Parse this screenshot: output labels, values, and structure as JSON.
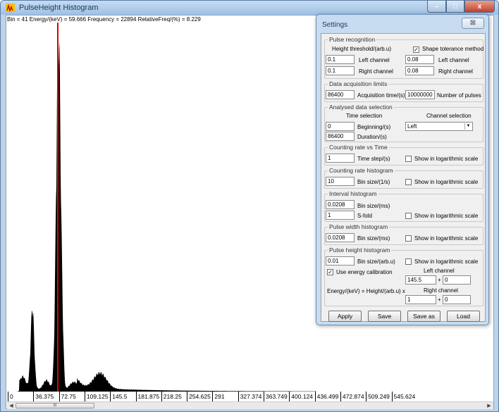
{
  "window": {
    "title": "PulseHeight Histogram",
    "info_line": "Bin = 41  Energy/(keV) = 59.666  Frequency = 22894  RelativeFreq/(%) = 8.229",
    "buttons": {
      "minimize": "–",
      "maximize": "□",
      "close": "x"
    }
  },
  "histogram": {
    "bar_color": "#000000",
    "marker_color": "#e00000",
    "marker_bin": 41,
    "axis_labels": [
      "0",
      "36.375",
      "72.75",
      "109.125",
      "145.5",
      "181.875",
      "218.25",
      "254.625",
      "291",
      "327.374",
      "363.749",
      "400.124",
      "436.499",
      "472.874",
      "509.249",
      "545.624"
    ],
    "scroll_thumb": "III"
  },
  "settings": {
    "title": "Settings",
    "close_glyph": "⊠",
    "pulse_recognition": {
      "title": "Pulse recognition",
      "height_threshold_label": "Height threshold/(arb.u)",
      "shape_tolerance_checked": true,
      "shape_tolerance_label": "Shape tolerance method",
      "left_value": "0.1",
      "left_label": "Left channel",
      "left_tol_value": "0.08",
      "left_tol_label": "Left channel",
      "right_value": "0.1",
      "right_label": "Right channel",
      "right_tol_value": "0.08",
      "right_tol_label": "Right channel"
    },
    "acquisition": {
      "title": "Data acquisition limits",
      "time_value": "86400",
      "time_label": "Acquisition time/(s)",
      "pulses_value": "10000000",
      "pulses_label": "Number of pulses"
    },
    "analysed": {
      "title": "Analysed data selection",
      "time_selection_label": "Time selection",
      "channel_selection_label": "Channel selection",
      "beginning_value": "0",
      "beginning_label": "Beginning/(s)",
      "duration_value": "86400",
      "duration_label": "Duration/(s)",
      "channel_value": "Left"
    },
    "counting_rate_time": {
      "title": "Counting rate vs Time",
      "value": "1",
      "label": "Time step/(s)",
      "log_label": "Show in logarithmic scale"
    },
    "counting_rate_hist": {
      "title": "Counting rate histogram",
      "value": "10",
      "label": "Bin size/(1/s)",
      "log_label": "Show in logarithmic scale"
    },
    "interval_hist": {
      "title": "Interval histogram",
      "bin_value": "0.0208",
      "bin_label": "Bin size/(ms)",
      "fold_value": "1",
      "fold_label": "S-fold",
      "log_label": "Show in logarithmic scale"
    },
    "pulse_width_hist": {
      "title": "Pulse width histogram",
      "value": "0.0208",
      "label": "Bin size/(ms)",
      "log_label": "Show in logarithmic scale"
    },
    "pulse_height_hist": {
      "title": "Pulse height histogram",
      "value": "0.01",
      "label": "Bin size/(arb.u)",
      "log_label": "Show in logarithmic scale",
      "energy_cal_checked": true,
      "energy_cal_label": "Use energy calibration",
      "left_channel_label": "Left channel",
      "left_factor": "145.5",
      "left_offset": "0",
      "formula": "Energy/(keV) = Height/(arb.u)  x",
      "right_channel_label": "Right channel",
      "right_factor": "1",
      "right_offset": "0",
      "plus": "+"
    },
    "buttons": {
      "apply": "Apply",
      "save": "Save",
      "save_as": "Save as",
      "load": "Load"
    }
  }
}
